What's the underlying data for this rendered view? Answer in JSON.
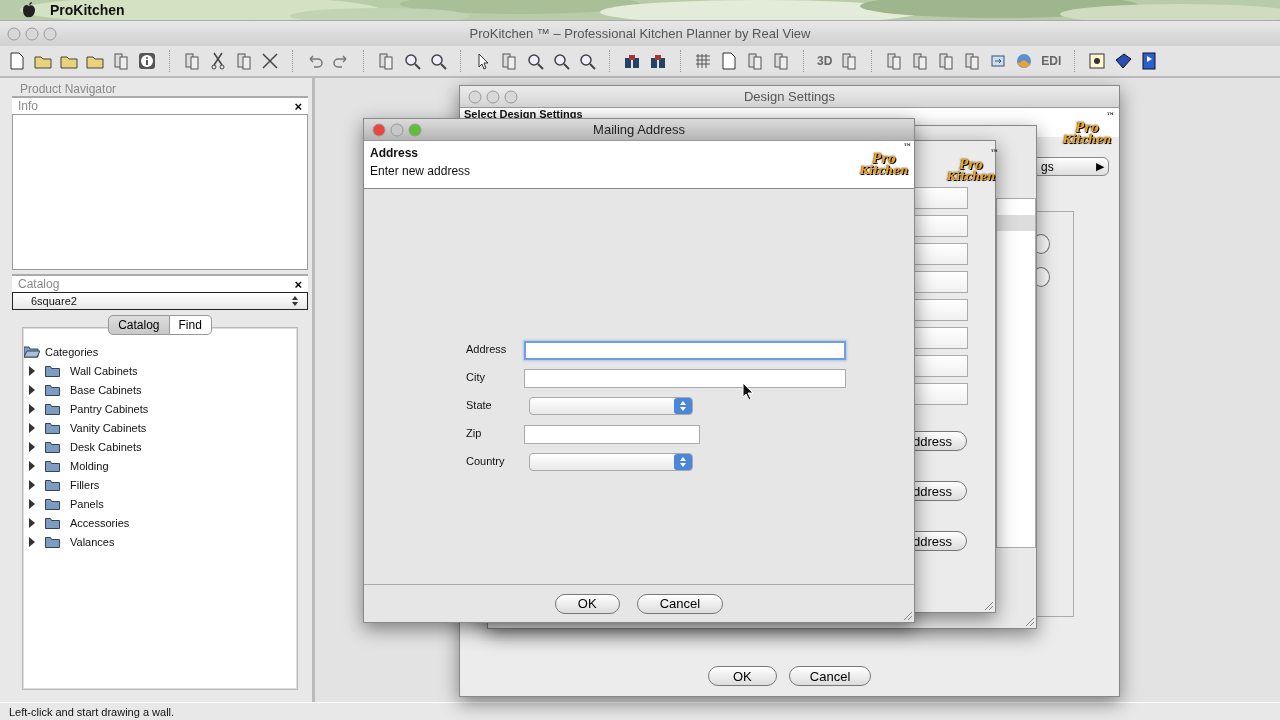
{
  "menu_bar": {
    "app_name": "ProKitchen"
  },
  "window": {
    "title": "ProKitchen ™ – Professional Kitchen Planner by Real View"
  },
  "toolbar": {
    "text_icons": [
      "3D",
      "EDI"
    ]
  },
  "sidebar": {
    "title": "Product Navigator",
    "info_panel": {
      "title": "Info",
      "close": "×"
    },
    "catalog_panel": {
      "title": "Catalog",
      "close": "×",
      "catalog_select": "6square2",
      "tabs": [
        {
          "label": "Catalog",
          "selected": true
        },
        {
          "label": "Find",
          "selected": false
        }
      ],
      "tree": [
        {
          "label": "Categories",
          "expanded": true,
          "children": [
            {
              "label": "Wall Cabinets",
              "expanded": false
            },
            {
              "label": "Base Cabinets",
              "expanded": false
            },
            {
              "label": "Pantry Cabinets",
              "expanded": false
            },
            {
              "label": "Vanity Cabinets",
              "expanded": false
            },
            {
              "label": "Desk Cabinets",
              "expanded": false
            },
            {
              "label": "Molding",
              "expanded": false
            },
            {
              "label": "Fillers",
              "expanded": false
            },
            {
              "label": "Panels",
              "expanded": false
            },
            {
              "label": "Accessories",
              "expanded": false
            },
            {
              "label": "Valances",
              "expanded": false
            }
          ]
        }
      ]
    }
  },
  "design_settings": {
    "title": "Design Settings",
    "heading": "Select Design Settings",
    "logo": {
      "line1": "Pro",
      "line2": "Kitchen",
      "tm": "™"
    },
    "tab": "gs",
    "tab_arrow": "▶",
    "radios": [
      {
        "selected": false
      },
      {
        "selected": false
      }
    ],
    "buttons": [
      "OK",
      "Cancel"
    ]
  },
  "address_list_window": {
    "logo": {
      "line1": "Pro",
      "line2": "Kitchen",
      "tm": "™"
    },
    "address_buttons": [
      "ddress",
      "ddress",
      "ddress"
    ]
  },
  "mailing_address": {
    "title": "Mailing Address",
    "heading": "Address",
    "subheading": "Enter new address",
    "logo": {
      "line1": "Pro",
      "line2": "Kitchen",
      "tm": "™"
    },
    "fields": [
      {
        "label": "Address",
        "kind": "text",
        "focused": true
      },
      {
        "label": "City",
        "kind": "text",
        "focused": false
      },
      {
        "label": "State",
        "kind": "select"
      },
      {
        "label": "Zip",
        "kind": "short",
        "focused": false
      },
      {
        "label": "Country",
        "kind": "select"
      }
    ],
    "buttons": [
      "OK",
      "Cancel"
    ]
  },
  "status_bar": {
    "text": "Left-click and start drawing a wall."
  }
}
